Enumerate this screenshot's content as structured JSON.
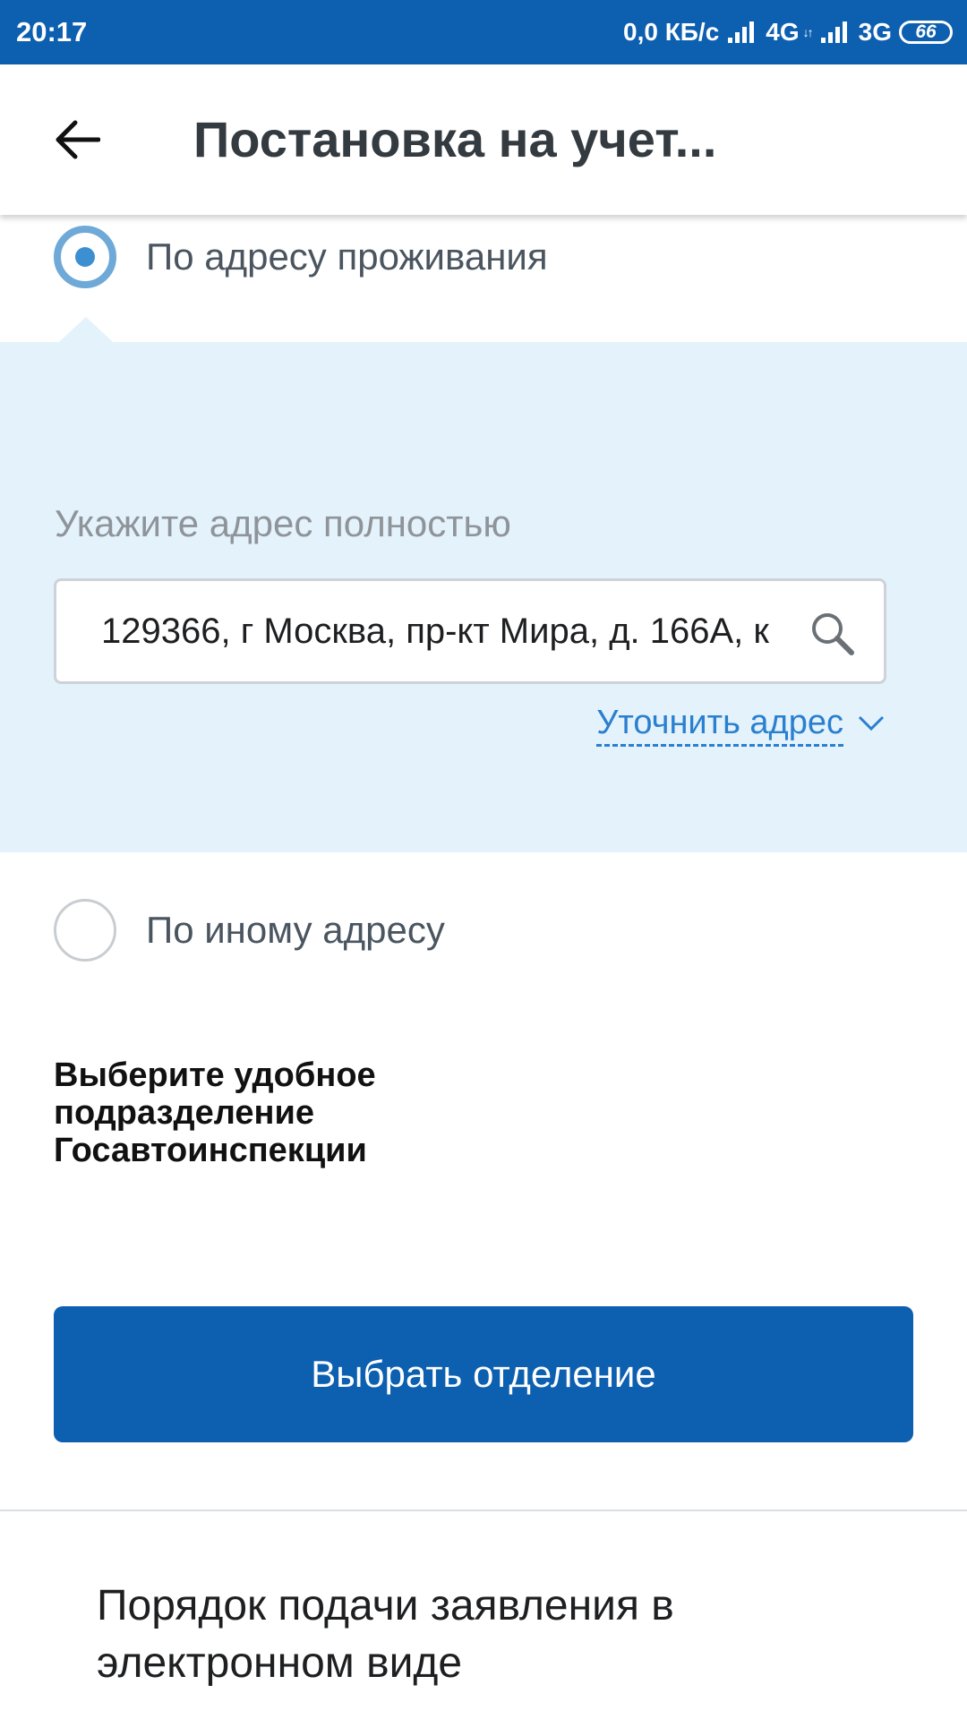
{
  "status_bar": {
    "time": "20:17",
    "network_speed": "0,0 КБ/с",
    "network_1": "4G",
    "network_2": "3G",
    "battery": "66"
  },
  "header": {
    "title": "Постановка на учет..."
  },
  "address_options": [
    {
      "label": "По адресу проживания",
      "selected": true
    },
    {
      "label": "По иному адресу",
      "selected": false
    }
  ],
  "address_panel": {
    "caption": "Укажите адрес полностью",
    "address_value": "129366, г Москва, пр-кт Мира, д. 166А, к",
    "refine_link": "Уточнить адрес"
  },
  "department": {
    "heading": "Выберите удобное подразделение Госавтоинспекции",
    "button_label": "Выбрать отделение"
  },
  "footer": {
    "link_text": "Порядок подачи заявления в электронном виде"
  },
  "colors": {
    "brand_blue": "#0d5fb0",
    "panel_bg": "#e4f2fb",
    "link_blue": "#2a7fcf",
    "radio_blue": "#6ea9d8"
  },
  "icons": [
    "back-arrow-icon",
    "search-icon",
    "chevron-down-icon",
    "signal-icon",
    "battery-icon"
  ]
}
